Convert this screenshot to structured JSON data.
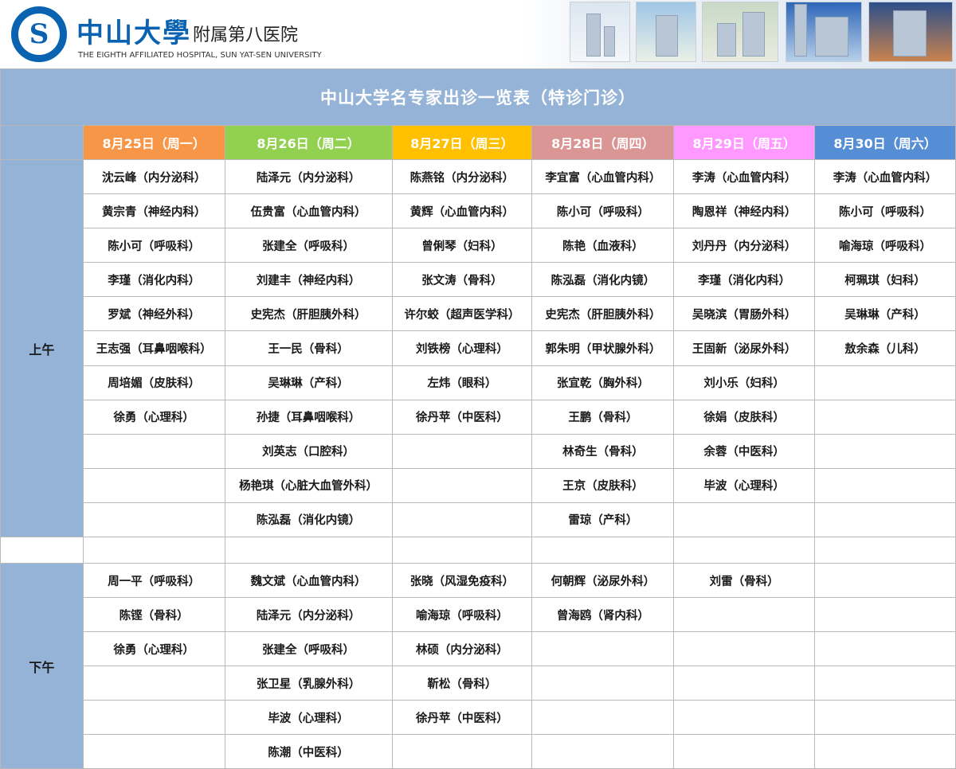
{
  "header": {
    "logo_text": "中山大学附属第八医院",
    "brand_cn": "中山大學",
    "brand_cn_sub": "附属第八医院",
    "brand_en": "THE EIGHTH AFFILIATED HOSPITAL, SUN YAT-SEN UNIVERSITY"
  },
  "table": {
    "title": "中山大学名专家出诊一览表（特诊门诊）",
    "dates": [
      "8月25日（周一）",
      "8月26日（周二）",
      "8月27日（周三）",
      "8月28日（周四）",
      "8月29日（周五）",
      "8月30日（周六）"
    ],
    "am_label": "上午",
    "pm_label": "下午",
    "am": [
      [
        "沈云峰（内分泌科）",
        "陆泽元（内分泌科）",
        "陈燕铭（内分泌科）",
        "李宜富（心血管内科）",
        "李涛（心血管内科）",
        "李涛（心血管内科）"
      ],
      [
        "黄宗青（神经内科）",
        "伍贵富（心血管内科）",
        "黄辉（心血管内科）",
        "陈小可（呼吸科）",
        "陶恩祥（神经内科）",
        "陈小可（呼吸科）"
      ],
      [
        "陈小可（呼吸科）",
        "张建全（呼吸科）",
        "曾俐琴（妇科）",
        "陈艳（血液科）",
        "刘丹丹（内分泌科）",
        "喻海琼（呼吸科）"
      ],
      [
        "李瑾（消化内科）",
        "刘建丰（神经内科）",
        "张文涛（骨科）",
        "陈泓磊（消化内镜）",
        "李瑾（消化内科）",
        "柯珮琪（妇科）"
      ],
      [
        "罗斌（神经外科）",
        "史宪杰（肝胆胰外科）",
        "许尔蛟（超声医学科）",
        "史宪杰（肝胆胰外科）",
        "吴晓滨（胃肠外科）",
        "吴琳琳（产科）"
      ],
      [
        "王志强（耳鼻咽喉科）",
        "王一民（骨科）",
        "刘铁榜（心理科）",
        "郭朱明（甲状腺外科）",
        "王固新（泌尿外科）",
        "敖余森（儿科）"
      ],
      [
        "周培媚（皮肤科）",
        "吴琳琳（产科）",
        "左炜（眼科）",
        "张宜乾（胸外科）",
        "刘小乐（妇科）",
        ""
      ],
      [
        "徐勇（心理科）",
        "孙捷（耳鼻咽喉科）",
        "徐丹苹（中医科）",
        "王鹏（骨科）",
        "徐娟（皮肤科）",
        ""
      ],
      [
        "",
        "刘英志（口腔科）",
        "",
        "林奇生（骨科）",
        "余蓉（中医科）",
        ""
      ],
      [
        "",
        "杨艳琪（心脏大血管外科）",
        "",
        "王京（皮肤科）",
        "毕波（心理科）",
        ""
      ],
      [
        "",
        "陈泓磊（消化内镜）",
        "",
        "雷琼（产科）",
        "",
        ""
      ]
    ],
    "pm": [
      [
        "周一平（呼吸科）",
        "魏文斌（心血管内科）",
        "张晓（风湿免疫科）",
        "何朝辉（泌尿外科）",
        "刘雷（骨科）",
        ""
      ],
      [
        "陈铿（骨科）",
        "陆泽元（内分泌科）",
        "喻海琼（呼吸科）",
        "曾海鸥（肾内科）",
        "",
        ""
      ],
      [
        "徐勇（心理科）",
        "张建全（呼吸科）",
        "林硕（内分泌科）",
        "",
        "",
        ""
      ],
      [
        "",
        "张卫星（乳腺外科）",
        "靳松（骨科）",
        "",
        "",
        ""
      ],
      [
        "",
        "毕波（心理科）",
        "徐丹苹（中医科）",
        "",
        "",
        ""
      ],
      [
        "",
        "陈潮（中医科）",
        "",
        "",
        "",
        ""
      ]
    ]
  }
}
